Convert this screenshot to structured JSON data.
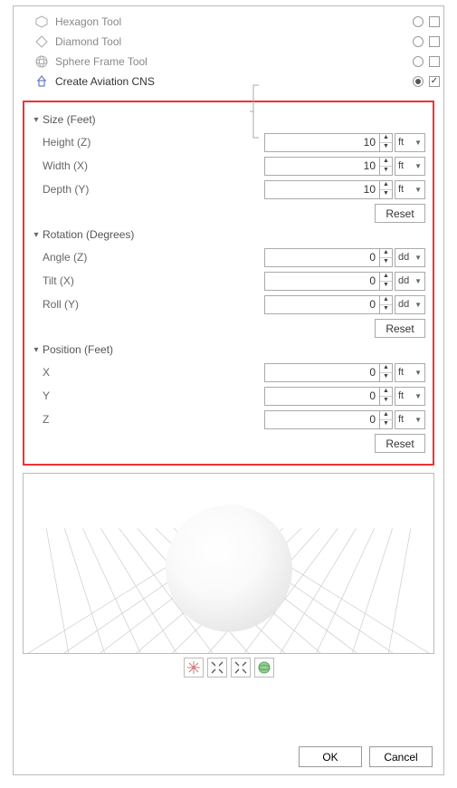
{
  "tools": [
    {
      "label": "Hexagon Tool",
      "selected": false,
      "checked": false
    },
    {
      "label": "Diamond Tool",
      "selected": false,
      "checked": false
    },
    {
      "label": "Sphere Frame Tool",
      "selected": false,
      "checked": false
    },
    {
      "label": "Create Aviation CNS",
      "selected": true,
      "checked": true
    }
  ],
  "size": {
    "heading": "Size (Feet)",
    "fields": [
      {
        "label": "Height (Z)",
        "value": "10",
        "unit": "ft"
      },
      {
        "label": "Width (X)",
        "value": "10",
        "unit": "ft"
      },
      {
        "label": "Depth (Y)",
        "value": "10",
        "unit": "ft"
      }
    ],
    "reset": "Reset"
  },
  "rotation": {
    "heading": "Rotation (Degrees)",
    "fields": [
      {
        "label": "Angle (Z)",
        "value": "0",
        "unit": "dd"
      },
      {
        "label": "Tilt (X)",
        "value": "0",
        "unit": "dd"
      },
      {
        "label": "Roll (Y)",
        "value": "0",
        "unit": "dd"
      }
    ],
    "reset": "Reset"
  },
  "position": {
    "heading": "Position (Feet)",
    "fields": [
      {
        "label": "X",
        "value": "0",
        "unit": "ft"
      },
      {
        "label": "Y",
        "value": "0",
        "unit": "ft"
      },
      {
        "label": "Z",
        "value": "0",
        "unit": "ft"
      }
    ],
    "reset": "Reset"
  },
  "footer": {
    "ok": "OK",
    "cancel": "Cancel"
  },
  "toolbar_icons": [
    "grid",
    "fit",
    "expand",
    "globe"
  ]
}
